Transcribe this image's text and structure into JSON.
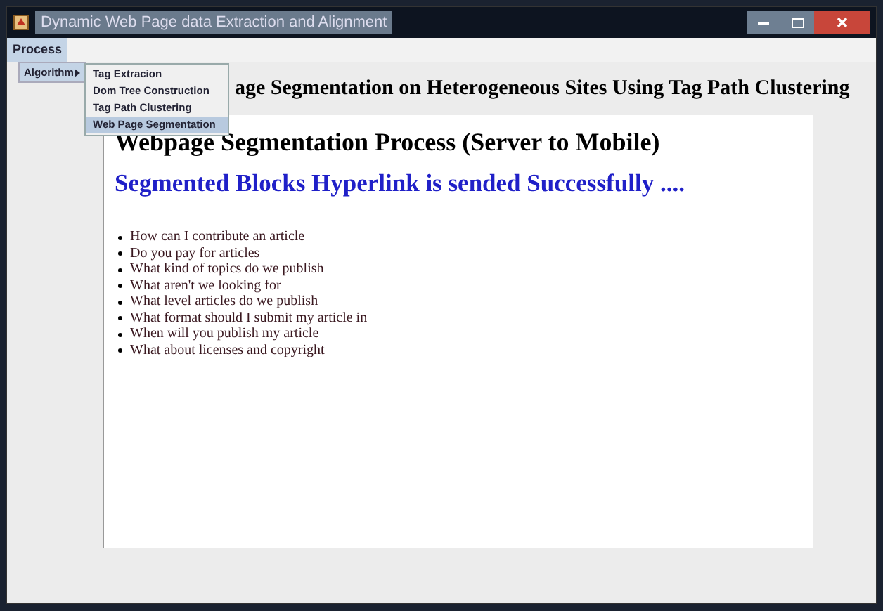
{
  "window": {
    "title": "Dynamic Web Page data Extraction and Alignment"
  },
  "menu_bar": [
    {
      "label": "Process",
      "selected": true
    }
  ],
  "menu": {
    "label": "Algorithm",
    "expanded": true
  },
  "submenu": [
    {
      "label": "Tag Extracion",
      "selected": false
    },
    {
      "label": "Dom Tree Construction",
      "selected": false
    },
    {
      "label": "Tag Path Clustering",
      "selected": false
    },
    {
      "label": "Web Page Segmentation",
      "selected": true
    }
  ],
  "heading": "age Segmentation on Heterogeneous Sites Using Tag Path Clustering",
  "page": {
    "title": "Webpage Segmentation Process (Server to Mobile)",
    "status": "Segmented Blocks Hyperlink is sended Successfully ....",
    "items": [
      "How can I contribute an article",
      "Do you pay for articles",
      "What kind of topics do we publish",
      "What aren't we looking for",
      "What level articles do we publish",
      "What format should I submit my article in",
      "When will you publish my article",
      "What about licenses and copyright"
    ]
  }
}
